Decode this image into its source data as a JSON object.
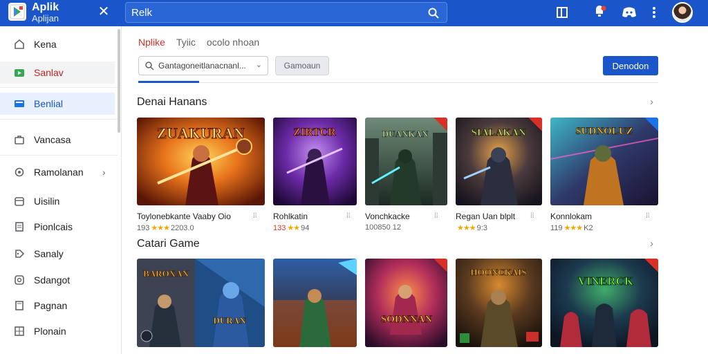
{
  "app": {
    "title": "Aplik",
    "subtitle": "Aplijan",
    "search_value": "Relk"
  },
  "sidebar": {
    "items": [
      {
        "label": "Kena",
        "icon": "home-icon"
      },
      {
        "label": "Sanlav",
        "icon": "play-store-icon"
      },
      {
        "label": "Benlial",
        "icon": "book-icon"
      },
      {
        "label": "Vancasa",
        "icon": "briefcase-icon"
      },
      {
        "label": "Ramolanan",
        "icon": "category-icon"
      },
      {
        "label": "Uisilin",
        "icon": "box-icon"
      },
      {
        "label": "Pionlcais",
        "icon": "document-icon"
      },
      {
        "label": "Sanaly",
        "icon": "tag-icon"
      },
      {
        "label": "Sdangot",
        "icon": "refresh-icon"
      },
      {
        "label": "Pagnan",
        "icon": "page-icon"
      },
      {
        "label": "Plonain",
        "icon": "grid-icon"
      }
    ]
  },
  "tabs": [
    {
      "label": "Nplike"
    },
    {
      "label": "Tyiic"
    },
    {
      "label": "ocolo nhoan"
    }
  ],
  "filter": {
    "value": "Gantagoneitlanacnanl..."
  },
  "buttons": {
    "community": "Gamoaun",
    "primary": "Denodon"
  },
  "sections": [
    {
      "title": "Denai Hanans",
      "cards": [
        {
          "title": "Toylonebkante Vaaby Oio",
          "rating_count": "193",
          "score": "2203.0",
          "art_text": "ZUAKURAN"
        },
        {
          "title": "Rohlkatin",
          "rating_count": "133",
          "score": "94",
          "art_text": "ZIRTCR"
        },
        {
          "title": "Vonchkacke",
          "rating_count": "100850",
          "score": "12",
          "art_text": "DUANKAN"
        },
        {
          "title": "Regan Uan blplt",
          "rating_count": "",
          "score": "9:3",
          "art_text": "SIALAKAN"
        },
        {
          "title": "Konnlokam",
          "rating_count": "119",
          "score": "K2",
          "art_text": "SUDNOLUZ"
        }
      ]
    },
    {
      "title": "Catari Game",
      "cards": [
        {
          "art_text": "BAROXAN",
          "art_sub": "DURAN"
        },
        {
          "art_text": ""
        },
        {
          "art_text": "SODNNAN"
        },
        {
          "art_text": "HOONCKAIS"
        },
        {
          "art_text": "VINERCK"
        }
      ]
    }
  ],
  "colors": {
    "brand": "#1a56c9",
    "accent_red": "#d93025",
    "star": "#f2a600"
  }
}
